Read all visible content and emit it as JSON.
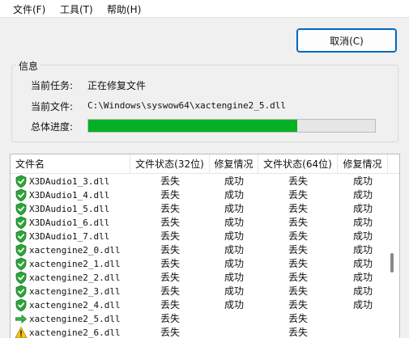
{
  "menu": {
    "file": "文件(F)",
    "tools": "工具(T)",
    "help": "帮助(H)"
  },
  "cancel_button": "取消(C)",
  "info": {
    "title": "信息",
    "task_label": "当前任务:",
    "task_value": "正在修复文件",
    "file_label": "当前文件:",
    "file_value": "C:\\Windows\\syswow64\\xactengine2_5.dll",
    "progress_label": "总体进度:",
    "progress_percent": 73
  },
  "table": {
    "headers": [
      "文件名",
      "文件状态(32位)",
      "修复情况",
      "文件状态(64位)",
      "修复情况"
    ],
    "rows": [
      {
        "icon": "shield-check-icon",
        "name": "X3DAudio1_3.dll",
        "status32": "丢失",
        "fix32": "成功",
        "status64": "丢失",
        "fix64": "成功"
      },
      {
        "icon": "shield-check-icon",
        "name": "X3DAudio1_4.dll",
        "status32": "丢失",
        "fix32": "成功",
        "status64": "丢失",
        "fix64": "成功"
      },
      {
        "icon": "shield-check-icon",
        "name": "X3DAudio1_5.dll",
        "status32": "丢失",
        "fix32": "成功",
        "status64": "丢失",
        "fix64": "成功"
      },
      {
        "icon": "shield-check-icon",
        "name": "X3DAudio1_6.dll",
        "status32": "丢失",
        "fix32": "成功",
        "status64": "丢失",
        "fix64": "成功"
      },
      {
        "icon": "shield-check-icon",
        "name": "X3DAudio1_7.dll",
        "status32": "丢失",
        "fix32": "成功",
        "status64": "丢失",
        "fix64": "成功"
      },
      {
        "icon": "shield-check-icon",
        "name": "xactengine2_0.dll",
        "status32": "丢失",
        "fix32": "成功",
        "status64": "丢失",
        "fix64": "成功"
      },
      {
        "icon": "shield-check-icon",
        "name": "xactengine2_1.dll",
        "status32": "丢失",
        "fix32": "成功",
        "status64": "丢失",
        "fix64": "成功"
      },
      {
        "icon": "shield-check-icon",
        "name": "xactengine2_2.dll",
        "status32": "丢失",
        "fix32": "成功",
        "status64": "丢失",
        "fix64": "成功"
      },
      {
        "icon": "shield-check-icon",
        "name": "xactengine2_3.dll",
        "status32": "丢失",
        "fix32": "成功",
        "status64": "丢失",
        "fix64": "成功"
      },
      {
        "icon": "shield-check-icon",
        "name": "xactengine2_4.dll",
        "status32": "丢失",
        "fix32": "成功",
        "status64": "丢失",
        "fix64": "成功"
      },
      {
        "icon": "green-arrow-icon",
        "name": "xactengine2_5.dll",
        "status32": "丢失",
        "fix32": "",
        "status64": "丢失",
        "fix64": ""
      },
      {
        "icon": "warning-icon",
        "name": "xactengine2_6.dll",
        "status32": "丢失",
        "fix32": "",
        "status64": "丢失",
        "fix64": ""
      }
    ]
  },
  "colors": {
    "progress": "#06b025",
    "accent": "#0067c0",
    "shield": "#2da43a",
    "warning": "#f5c518"
  }
}
